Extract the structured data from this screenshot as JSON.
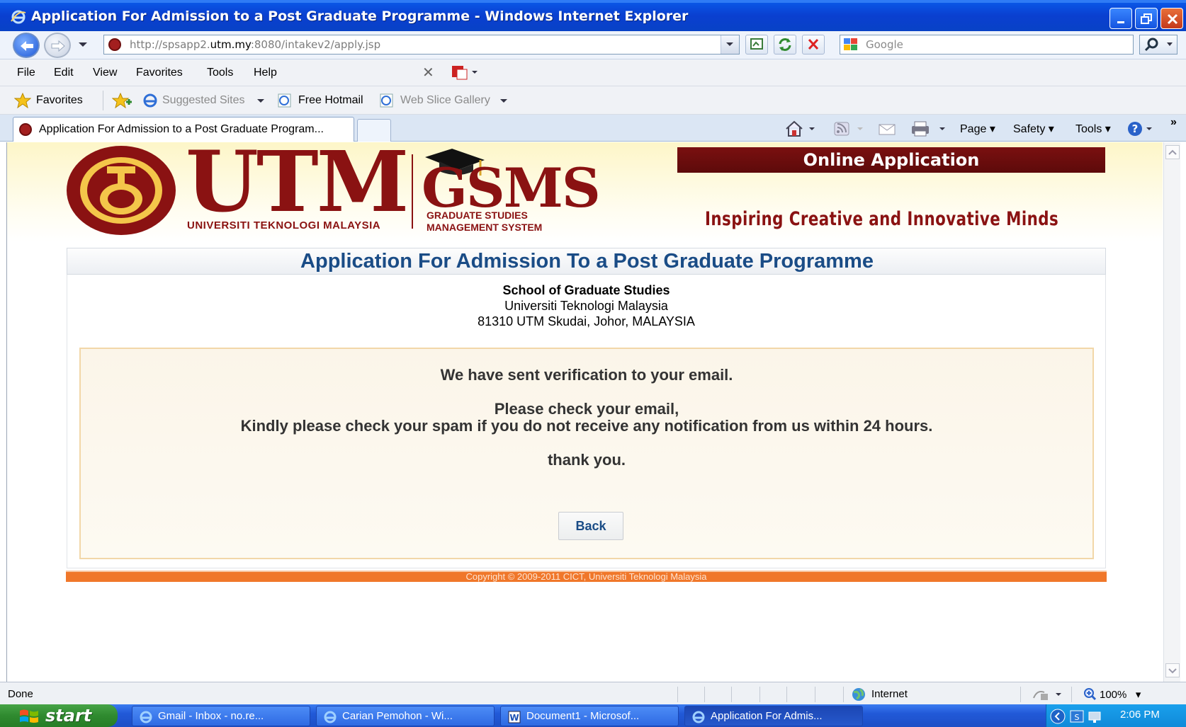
{
  "window": {
    "title": "Application For Admission to a Post Graduate Programme - Windows Internet Explorer"
  },
  "address_bar": {
    "url_prefix": "http://spsapp2.",
    "url_domain": "utm.my",
    "url_suffix": ":8080/intakev2/apply.jsp"
  },
  "search": {
    "placeholder": "Google"
  },
  "menu": [
    "File",
    "Edit",
    "View",
    "Favorites",
    "Tools",
    "Help"
  ],
  "favorites_bar": {
    "favorites_label": "Favorites",
    "items": [
      "Suggested Sites",
      "Free Hotmail",
      "Web Slice Gallery"
    ]
  },
  "tab": {
    "title": "Application For Admission to a Post Graduate Program..."
  },
  "command_bar": {
    "page": "Page",
    "safety": "Safety",
    "tools": "Tools"
  },
  "banner": {
    "logo_text": "UTM",
    "logo_sub": "UNIVERSITI TEKNOLOGI MALAYSIA",
    "gsms_text": "GSMS",
    "gsms_sub_1": "GRADUATE STUDIES",
    "gsms_sub_2": "MANAGEMENT SYSTEM",
    "online_application": "Online Application",
    "tagline": "Inspiring  Creative and Innovative Minds"
  },
  "page": {
    "heading": "Application For Admission To a Post Graduate Programme",
    "school_name": "School of Graduate Studies",
    "university": "Universiti Teknologi Malaysia",
    "address": "81310 UTM Skudai, Johor, MALAYSIA",
    "message_1": "We have sent verification to your email.",
    "message_2": "Please check your email,",
    "message_3": "Kindly please check your spam if you do not receive any notification from us within 24 hours.",
    "message_4": "thank you.",
    "back_button": "Back",
    "copyright": "Copyright © 2009-2011 CICT, Universiti Teknologi Malaysia"
  },
  "status_bar": {
    "status": "Done",
    "zone": "Internet",
    "zoom": "100%"
  },
  "taskbar": {
    "start": "start",
    "tasks": [
      "Gmail - Inbox - no.re...",
      "Carian Pemohon - Wi...",
      "Document1 - Microsof...",
      "Application For Admis..."
    ],
    "clock": "2:06 PM"
  },
  "colors": {
    "utm_maroon": "#8a1212",
    "heading_blue": "#1a4c86",
    "footer_orange": "#f0772a",
    "xp_blue": "#0a56e6"
  }
}
